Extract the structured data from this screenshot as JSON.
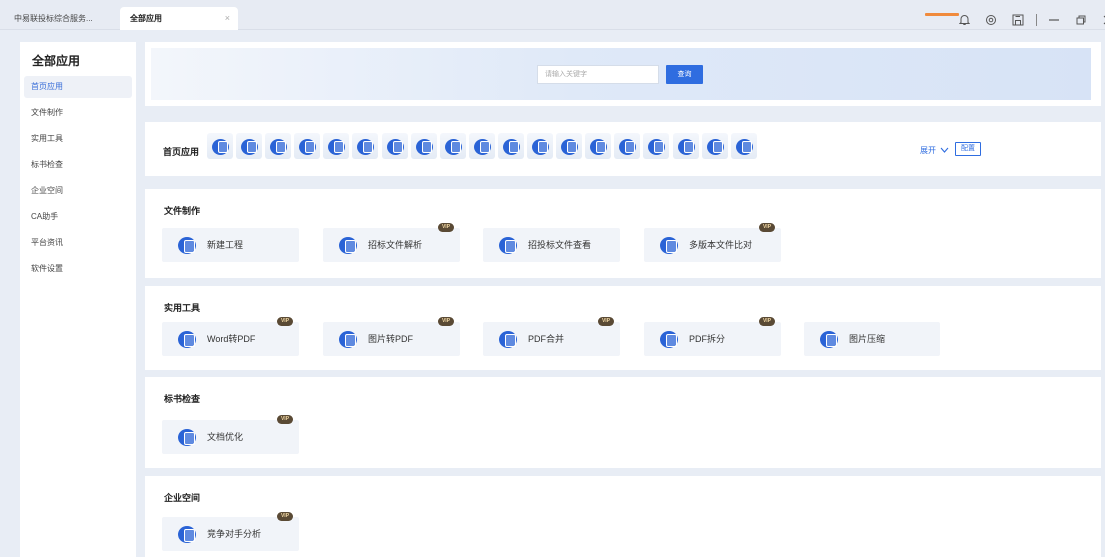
{
  "topbar": {
    "app_tab": "中易联投标综合服务...",
    "active_tab": "全部应用",
    "close_glyph": "×",
    "accent": "#f08a3c",
    "icons": [
      "bell-icon",
      "settings-icon",
      "save-icon",
      "minimize-icon",
      "restore-icon",
      "close-icon"
    ],
    "minimize_glyph": "—",
    "close_win_glyph": "×"
  },
  "sidebar": {
    "title": "全部应用",
    "items": [
      {
        "label": "首页应用",
        "active": true
      },
      {
        "label": "文件制作"
      },
      {
        "label": "实用工具"
      },
      {
        "label": "标书检查"
      },
      {
        "label": "企业空间"
      },
      {
        "label": "CA助手"
      },
      {
        "label": "平台资讯"
      },
      {
        "label": "软件设置"
      }
    ]
  },
  "search": {
    "placeholder": "请输入关键字",
    "button": "查询"
  },
  "home_apps": {
    "label": "首页应用",
    "icon_count": 19,
    "expand": "展开",
    "config": "配置"
  },
  "sections": {
    "file": {
      "title": "文件制作",
      "apps": [
        {
          "label": "新建工程",
          "vip": false
        },
        {
          "label": "招标文件解析",
          "vip": true
        },
        {
          "label": "招投标文件查看",
          "vip": false
        },
        {
          "label": "多版本文件比对",
          "vip": true
        }
      ]
    },
    "tools": {
      "title": "实用工具",
      "apps": [
        {
          "label": "Word转PDF",
          "vip": true
        },
        {
          "label": "图片转PDF",
          "vip": true
        },
        {
          "label": "PDF合并",
          "vip": true
        },
        {
          "label": "PDF拆分",
          "vip": true
        },
        {
          "label": "图片压缩",
          "vip": false
        }
      ]
    },
    "check": {
      "title": "标书检查",
      "apps": [
        {
          "label": "文档优化",
          "vip": true
        }
      ]
    },
    "enterprise": {
      "title": "企业空间",
      "apps": [
        {
          "label": "竞争对手分析",
          "vip": true
        }
      ]
    }
  },
  "vip_label": "VIP",
  "colors": {
    "primary": "#2f6de0",
    "icon_blue": "#2a63d6",
    "background": "#e8edf5",
    "vip_bg": "#5a4a35"
  }
}
